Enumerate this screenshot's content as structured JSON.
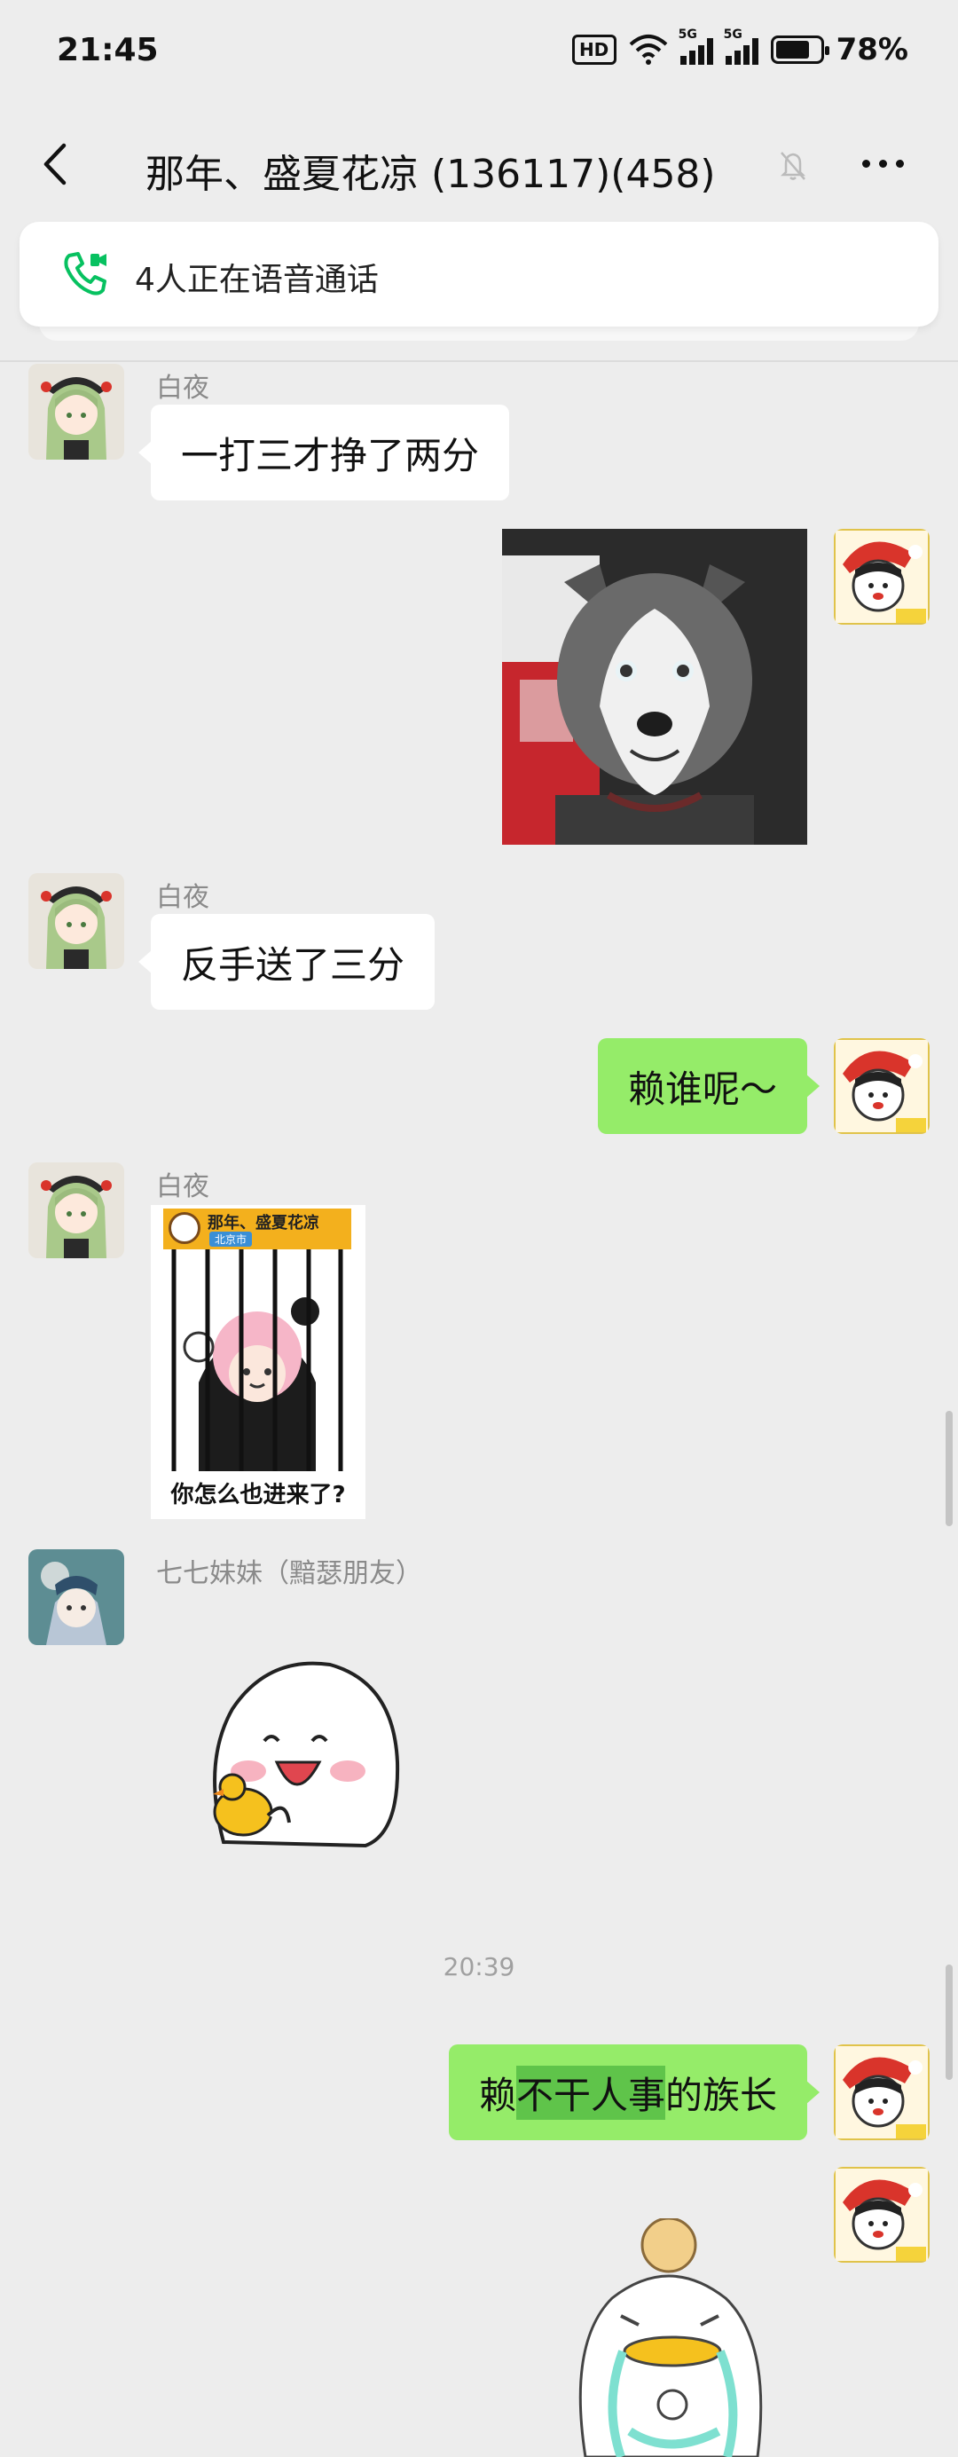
{
  "status_bar": {
    "time": "21:45",
    "hd": "HD",
    "net1": "5G",
    "net2": "5G",
    "battery": "78%",
    "battery_level": 0.78
  },
  "nav": {
    "title": "那年、盛夏花凉  (136117)(458)",
    "icons": [
      "back-icon",
      "mute-icon",
      "more-icon"
    ]
  },
  "call_banner": {
    "text": "4人正在语音通话",
    "icon": "phone-icon",
    "accent": "#07c160"
  },
  "messages": [
    {
      "side": "left",
      "sender": "白夜",
      "text": "一打三才挣了两分"
    },
    {
      "side": "right",
      "type": "image",
      "desc": "husky-sticker"
    },
    {
      "side": "left",
      "sender": "白夜",
      "text": "反手送了三分"
    },
    {
      "side": "right",
      "text": "赖谁呢～"
    },
    {
      "side": "left",
      "sender": "白夜",
      "type": "image",
      "sticker_title": "那年、盛夏花凉",
      "sticker_subtitle": "北京市",
      "sticker_caption": "你怎么也进来了?"
    },
    {
      "side": "left",
      "sender": "七七妹妹（黯瑟朋友）",
      "type": "sticker",
      "desc": "blob-with-duck-sticker"
    },
    {
      "type": "time",
      "text": "20:39"
    },
    {
      "side": "right",
      "text_parts": [
        "赖",
        "不干人事",
        "的族长"
      ]
    },
    {
      "side": "right",
      "type": "sticker",
      "desc": "crying-blob-sticker"
    }
  ],
  "colors": {
    "bg": "#ededed",
    "green_bubble": "#95ec69",
    "white_bubble": "#ffffff",
    "highlight": "#5fc44a"
  }
}
